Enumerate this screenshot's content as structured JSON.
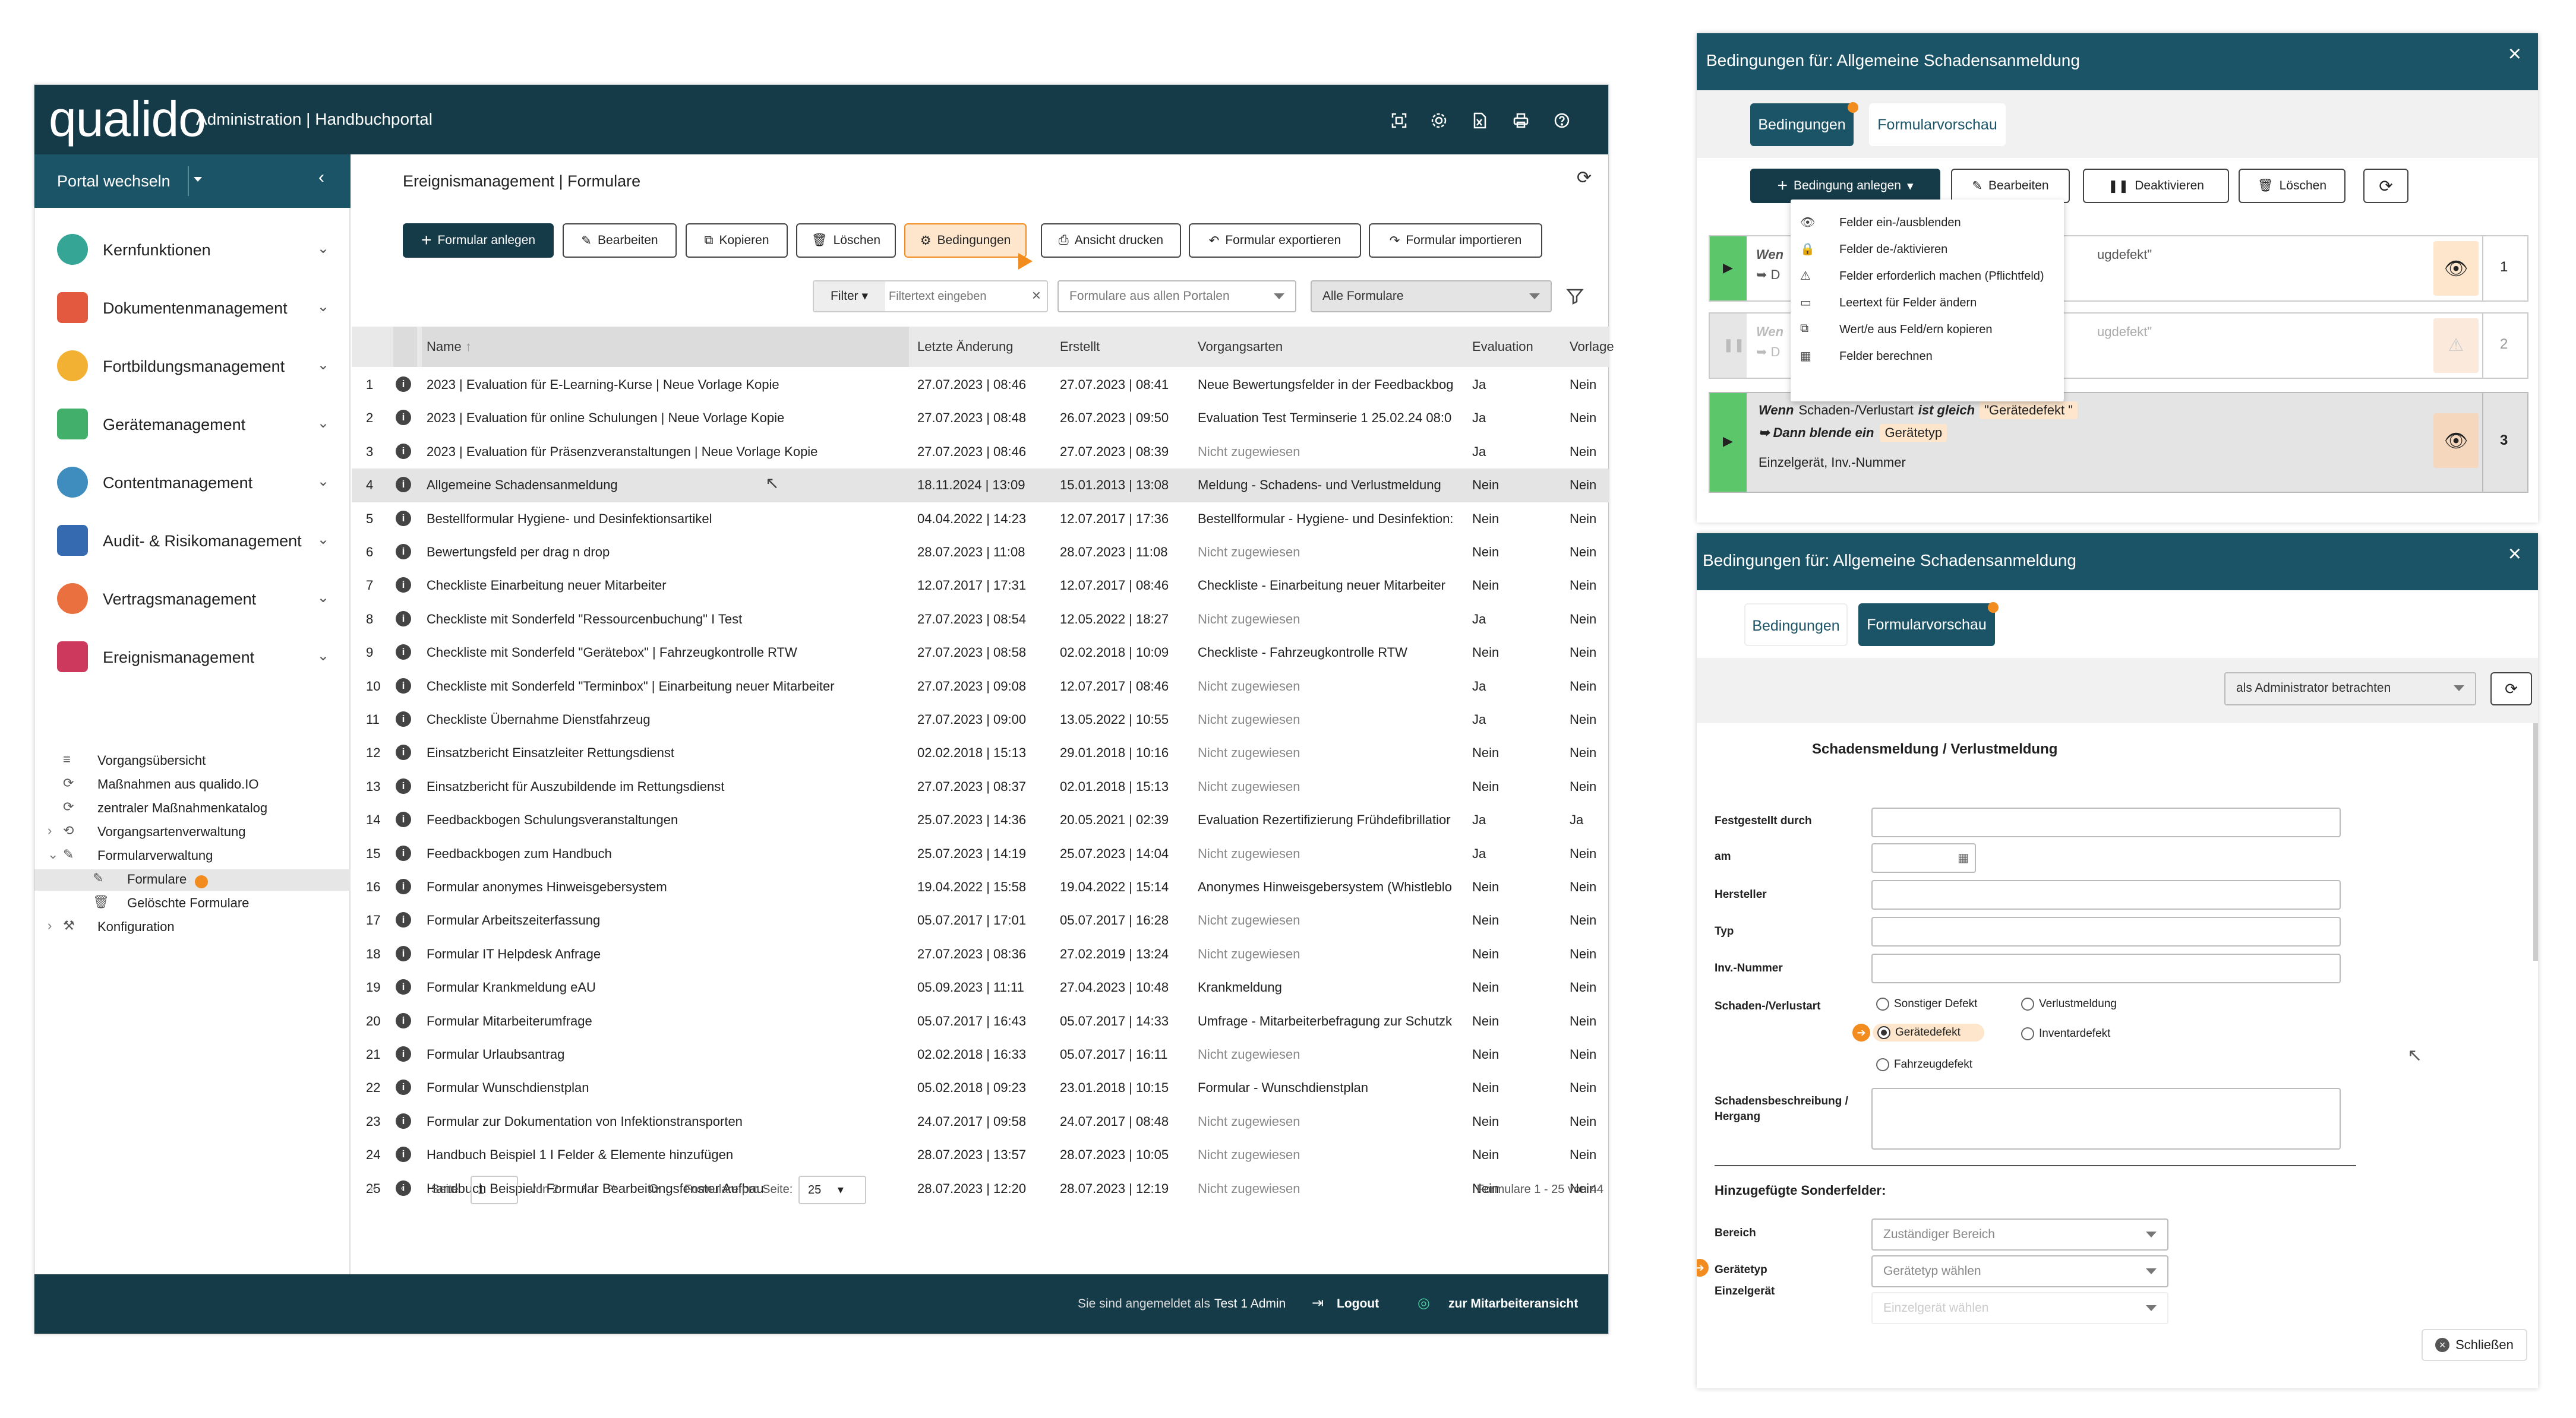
{
  "app": {
    "logo": "qualido",
    "title": "Administration | Handbuchportal",
    "portal_switch": "Portal wechseln"
  },
  "sidebar": {
    "modules": [
      {
        "label": "Kernfunktionen",
        "color": "#1f9b8a"
      },
      {
        "label": "Dokumentenmanagement",
        "color": "#e0472b"
      },
      {
        "label": "Fortbildungsmanagement",
        "color": "#f2a81d"
      },
      {
        "label": "Gerätemanagement",
        "color": "#2da65b"
      },
      {
        "label": "Contentmanagement",
        "color": "#2a7fb8"
      },
      {
        "label": "Audit- & Risikomanagement",
        "color": "#1f5aa8"
      },
      {
        "label": "Vertragsmanagement",
        "color": "#e8622a"
      },
      {
        "label": "Ereignismanagement",
        "color": "#c8234a"
      }
    ],
    "subitems": [
      {
        "label": "Vorgangsübersicht"
      },
      {
        "label": "Maßnahmen aus qualido.IO"
      },
      {
        "label": "zentraler Maßnahmenkatalog"
      },
      {
        "label": "Vorgangsartenverwaltung"
      },
      {
        "label": "Formularverwaltung"
      },
      {
        "label": "Formulare"
      },
      {
        "label": "Gelöschte Formulare"
      },
      {
        "label": "Konfiguration"
      }
    ]
  },
  "content": {
    "breadcrumb": "Ereignismanagement | Formulare",
    "toolbar": {
      "create": "Formular anlegen",
      "edit": "Bearbeiten",
      "copy": "Kopieren",
      "delete": "Löschen",
      "conditions": "Bedingungen",
      "print": "Ansicht drucken",
      "export": "Formular exportieren",
      "import": "Formular importieren"
    },
    "filter": {
      "label": "Filter",
      "placeholder": "Filtertext eingeben",
      "portal_select": "Formulare aus allen Portalen",
      "type_select": "Alle Formulare"
    },
    "columns": [
      "Name",
      "Letzte Änderung",
      "Erstellt",
      "Vorgangsarten",
      "Evaluation",
      "Vorlage"
    ],
    "rows": [
      {
        "n": "1",
        "name": "2023 | Evaluation für E-Learning-Kurse | Neue Vorlage Kopie",
        "changed": "27.07.2023 | 08:46",
        "created": "27.07.2023 | 08:41",
        "types": "Neue Bewertungsfelder in der Feedbackbog",
        "eval": "Ja",
        "tpl": "Nein"
      },
      {
        "n": "2",
        "name": "2023 | Evaluation für online Schulungen | Neue Vorlage Kopie",
        "changed": "27.07.2023 | 08:48",
        "created": "26.07.2023 | 09:50",
        "types": "Evaluation Test Terminserie 1 25.02.24 08:0",
        "eval": "Ja",
        "tpl": "Nein"
      },
      {
        "n": "3",
        "name": "2023 | Evaluation für Präsenzveranstaltungen | Neue Vorlage Kopie",
        "changed": "27.07.2023 | 08:46",
        "created": "27.07.2023 | 08:39",
        "types": "Nicht zugewiesen",
        "eval": "Ja",
        "tpl": "Nein"
      },
      {
        "n": "4",
        "name": "Allgemeine Schadensanmeldung",
        "changed": "18.11.2024 | 13:09",
        "created": "15.01.2013 | 13:08",
        "types": "Meldung - Schadens- und Verlustmeldung",
        "eval": "Nein",
        "tpl": "Nein"
      },
      {
        "n": "5",
        "name": "Bestellformular Hygiene- und Desinfektionsartikel",
        "changed": "04.04.2022 | 14:23",
        "created": "12.07.2017 | 17:36",
        "types": "Bestellformular - Hygiene- und Desinfektion:",
        "eval": "Nein",
        "tpl": "Nein"
      },
      {
        "n": "6",
        "name": "Bewertungsfeld per drag n drop",
        "changed": "28.07.2023 | 11:08",
        "created": "28.07.2023 | 11:08",
        "types": "Nicht zugewiesen",
        "eval": "Nein",
        "tpl": "Nein"
      },
      {
        "n": "7",
        "name": "Checkliste Einarbeitung neuer Mitarbeiter",
        "changed": "12.07.2017 | 17:31",
        "created": "12.07.2017 | 08:46",
        "types": "Checkliste - Einarbeitung neuer Mitarbeiter",
        "eval": "Nein",
        "tpl": "Nein"
      },
      {
        "n": "8",
        "name": "Checkliste mit Sonderfeld \"Ressourcenbuchung\" I Test",
        "changed": "27.07.2023 | 08:54",
        "created": "12.05.2022 | 18:27",
        "types": "Nicht zugewiesen",
        "eval": "Ja",
        "tpl": "Nein"
      },
      {
        "n": "9",
        "name": "Checkliste mit Sonderfeld \"Gerätebox\" | Fahrzeugkontrolle RTW",
        "changed": "27.07.2023 | 08:58",
        "created": "02.02.2018 | 10:09",
        "types": "Checkliste - Fahrzeugkontrolle RTW",
        "eval": "Nein",
        "tpl": "Nein"
      },
      {
        "n": "10",
        "name": "Checkliste mit Sonderfeld \"Terminbox\" | Einarbeitung neuer Mitarbeiter",
        "changed": "27.07.2023 | 09:08",
        "created": "12.07.2017 | 08:46",
        "types": "Nicht zugewiesen",
        "eval": "Ja",
        "tpl": "Nein"
      },
      {
        "n": "11",
        "name": "Checkliste Übernahme Dienstfahrzeug",
        "changed": "27.07.2023 | 09:00",
        "created": "13.05.2022 | 10:55",
        "types": "Nicht zugewiesen",
        "eval": "Ja",
        "tpl": "Nein"
      },
      {
        "n": "12",
        "name": "Einsatzbericht Einsatzleiter Rettungsdienst",
        "changed": "02.02.2018 | 15:13",
        "created": "29.01.2018 | 10:16",
        "types": "Nicht zugewiesen",
        "eval": "Nein",
        "tpl": "Nein"
      },
      {
        "n": "13",
        "name": "Einsatzbericht für Auszubildende im Rettungsdienst",
        "changed": "27.07.2023 | 08:37",
        "created": "02.01.2018 | 15:13",
        "types": "Nicht zugewiesen",
        "eval": "Nein",
        "tpl": "Nein"
      },
      {
        "n": "14",
        "name": "Feedbackbogen Schulungsveranstaltungen",
        "changed": "25.07.2023 | 14:36",
        "created": "20.05.2021 | 02:39",
        "types": "Evaluation Rezertifizierung Frühdefibrillatior",
        "eval": "Ja",
        "tpl": "Ja"
      },
      {
        "n": "15",
        "name": "Feedbackbogen zum Handbuch",
        "changed": "25.07.2023 | 14:19",
        "created": "25.07.2023 | 14:04",
        "types": "Nicht zugewiesen",
        "eval": "Ja",
        "tpl": "Nein"
      },
      {
        "n": "16",
        "name": "Formular anonymes Hinweisgebersystem",
        "changed": "19.04.2022 | 15:58",
        "created": "19.04.2022 | 15:14",
        "types": "Anonymes Hinweisgebersystem (Whistleblo",
        "eval": "Nein",
        "tpl": "Nein"
      },
      {
        "n": "17",
        "name": "Formular Arbeitszeiterfassung",
        "changed": "05.07.2017 | 17:01",
        "created": "05.07.2017 | 16:28",
        "types": "Nicht zugewiesen",
        "eval": "Nein",
        "tpl": "Nein"
      },
      {
        "n": "18",
        "name": "Formular IT Helpdesk Anfrage",
        "changed": "27.07.2023 | 08:36",
        "created": "27.02.2019 | 13:24",
        "types": "Nicht zugewiesen",
        "eval": "Nein",
        "tpl": "Nein"
      },
      {
        "n": "19",
        "name": "Formular Krankmeldung eAU",
        "changed": "05.09.2023 | 11:11",
        "created": "27.04.2023 | 10:48",
        "types": "Krankmeldung",
        "eval": "Nein",
        "tpl": "Nein"
      },
      {
        "n": "20",
        "name": "Formular Mitarbeiterumfrage",
        "changed": "05.07.2017 | 16:43",
        "created": "05.07.2017 | 14:33",
        "types": "Umfrage - Mitarbeiterbefragung zur Schutzk",
        "eval": "Nein",
        "tpl": "Nein"
      },
      {
        "n": "21",
        "name": "Formular Urlaubsantrag",
        "changed": "02.02.2018 | 16:33",
        "created": "05.07.2017 | 16:11",
        "types": "Nicht zugewiesen",
        "eval": "Nein",
        "tpl": "Nein"
      },
      {
        "n": "22",
        "name": "Formular Wunschdienstplan",
        "changed": "05.02.2018 | 09:23",
        "created": "23.01.2018 | 10:15",
        "types": "Formular - Wunschdienstplan",
        "eval": "Nein",
        "tpl": "Nein"
      },
      {
        "n": "23",
        "name": "Formular zur Dokumentation von Infektionstransporten",
        "changed": "24.07.2017 | 09:58",
        "created": "24.07.2017 | 08:48",
        "types": "Nicht zugewiesen",
        "eval": "Nein",
        "tpl": "Nein"
      },
      {
        "n": "24",
        "name": "Handbuch Beispiel 1 I Felder & Elemente hinzufügen",
        "changed": "28.07.2023 | 13:57",
        "created": "28.07.2023 | 10:05",
        "types": "Nicht zugewiesen",
        "eval": "Nein",
        "tpl": "Nein"
      },
      {
        "n": "25",
        "name": "Handbuch Beispiel I Formular Bearbeitungsfenster Aufbau",
        "changed": "28.07.2023 | 12:20",
        "created": "28.07.2023 | 12:19",
        "types": "Nicht zugewiesen",
        "eval": "Nein",
        "tpl": "Nein"
      }
    ],
    "pager": {
      "page_label": "Seite",
      "page": "1",
      "of": "von 2",
      "per_page_label": "Formulare pro Seite:",
      "per_page": "25",
      "summary": "Formulare 1 - 25 von 44"
    },
    "footer": {
      "logged_in": "Sie sind angemeldet als",
      "user": "Test 1 Admin",
      "logout": "Logout",
      "employee_view": "zur Mitarbeiteransicht"
    }
  },
  "panel1": {
    "title": "Bedingungen für: Allgemeine Schadensanmeldung",
    "tab_conditions": "Bedingungen",
    "tab_preview": "Formularvorschau",
    "toolbar": {
      "create": "Bedingung anlegen",
      "edit": "Bearbeiten",
      "deactivate": "Deaktivieren",
      "delete": "Löschen"
    },
    "menu": [
      "Felder ein-/ausblenden",
      "Felder de-/aktivieren",
      "Felder erforderlich machen (Pflichtfeld)",
      "Leertext für Felder ändern",
      "Wert/e aus Feld/ern kopieren",
      "Felder berechnen"
    ],
    "cond1_partial": "ugdefekt\"",
    "cond1_num": "1",
    "cond1_wen": "Wen",
    "cond2_partial": "ugdefekt\"",
    "cond2_num": "2",
    "cond2_wen": "Wen",
    "cond3": {
      "wenn": "Wenn",
      "field": "Schaden-/Verlustart",
      "op": "ist gleich",
      "value": "\"Gerätedefekt \"",
      "then": "➥ Dann blende ein",
      "target": "Gerätetyp",
      "extra": "Einzelgerät, Inv.-Nummer",
      "num": "3"
    }
  },
  "panel2": {
    "title": "Bedingungen für: Allgemeine Schadensanmeldung",
    "tab_conditions": "Bedingungen",
    "tab_preview": "Formularvorschau",
    "view_as": "als Administrator betrachten",
    "form_title": "Schadensmeldung / Verlustmeldung",
    "labels": {
      "found_by": "Festgestellt durch",
      "date": "am",
      "manufacturer": "Hersteller",
      "type": "Typ",
      "inv": "Inv.-Nummer",
      "damage_type": "Schaden-/Verlustart",
      "desc1": "Schadensbeschreibung /",
      "desc2": "Hergang",
      "special_fields": "Hinzugefügte Sonderfelder:",
      "area": "Bereich",
      "device_type": "Gerätetyp",
      "single_device": "Einzelgerät"
    },
    "radios": [
      "Sonstiger Defekt",
      "Verlustmeldung",
      "Gerätedefekt",
      "Inventardefekt",
      "Fahrzeugdefekt"
    ],
    "area_placeholder": "Zuständiger Bereich",
    "device_type_placeholder": "Gerätetyp wählen",
    "single_device_placeholder": "Einzelgerät wählen",
    "close": "Schließen"
  },
  "colors": {
    "dark": "#153a48",
    "teal": "#1c5467",
    "accent": "#f28c1e",
    "row_highlight": "#e4e4e4"
  }
}
